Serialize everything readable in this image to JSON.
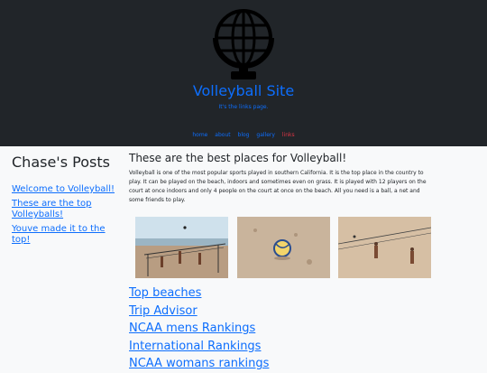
{
  "header": {
    "site_title": "Volleyball Site",
    "tagline": "It's the links page.",
    "logo_icon": "globe-icon",
    "nav": [
      {
        "label": "home",
        "active": false
      },
      {
        "label": "about",
        "active": false
      },
      {
        "label": "blog",
        "active": false
      },
      {
        "label": "gallery",
        "active": false
      },
      {
        "label": "links",
        "active": true
      }
    ]
  },
  "sidebar": {
    "title": "Chase's Posts",
    "posts": [
      "Welcome to Volleyball!",
      "These are the top Volleyballs!",
      "Youve made it to the top!"
    ]
  },
  "main": {
    "heading": "These are the best places for Volleyball!",
    "body": "Volleyball is one of the most popular sports played in southern California. It is the top place in the country to play. It can be played on the beach, indoors and sometimes even on grass. It is played with 12 players on the court at once indoors and only 4 people on the court at once on the beach. All you need is a ball, a net and some friends to play.",
    "links": [
      "Top beaches",
      "Trip Advisor",
      "NCAA mens Rankings",
      "International Rankings",
      "NCAA womans rankings"
    ]
  },
  "colors": {
    "header_bg": "#212529",
    "link": "#0d6efd",
    "active_link": "#dc3545",
    "page_bg": "#f8f9fa"
  }
}
